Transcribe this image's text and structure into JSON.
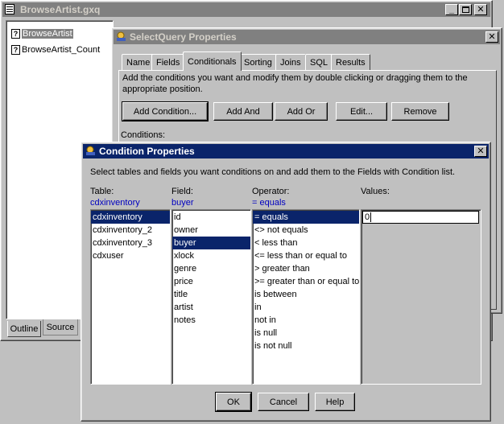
{
  "browse_window": {
    "title": "BrowseArtist.gxq",
    "tree_items": [
      {
        "label": "BrowseArtist",
        "selected": true
      },
      {
        "label": "BrowseArtist_Count",
        "selected": false
      }
    ],
    "tabs": [
      "Outline",
      "Source"
    ]
  },
  "select_query": {
    "title": "SelectQuery Properties",
    "tabs": [
      "Name",
      "Fields",
      "Conditionals",
      "Sorting",
      "Joins",
      "SQL",
      "Results"
    ],
    "active_tab": "Conditionals",
    "instructions": "Add the conditions you want and modify them by double clicking or dragging them to the appropriate position.",
    "buttons": {
      "add_condition": "Add Condition...",
      "add_and": "Add And",
      "add_or": "Add Or",
      "edit": "Edit...",
      "remove": "Remove"
    },
    "conditions_label": "Conditions:"
  },
  "condition_props": {
    "title": "Condition Properties",
    "instructions": "Select tables and fields you want conditions on and add them to the Fields with Condition list.",
    "table": {
      "label": "Table:",
      "current": "cdxinventory",
      "items": [
        "cdxinventory",
        "cdxinventory_2",
        "cdxinventory_3",
        "cdxuser"
      ],
      "selected_index": 0
    },
    "field": {
      "label": "Field:",
      "current": "buyer",
      "items": [
        "id",
        "owner",
        "buyer",
        "xlock",
        "genre",
        "price",
        "title",
        "artist",
        "notes"
      ],
      "selected_index": 2
    },
    "operator": {
      "label": "Operator:",
      "current": "= equals",
      "items": [
        "= equals",
        "<> not equals",
        "< less than",
        "<= less than or equal to",
        "> greater than",
        ">= greater than or equal to",
        "is between",
        "in",
        "not in",
        "is null",
        "is not null"
      ],
      "selected_index": 0
    },
    "values": {
      "label": "Values:",
      "input_value": "0"
    },
    "buttons": {
      "ok": "OK",
      "cancel": "Cancel",
      "help": "Help"
    }
  },
  "colors": {
    "active_title": "#0a246a",
    "inactive_title": "#808080",
    "selection": "#0a246a",
    "label_blue": "#0000c0"
  }
}
